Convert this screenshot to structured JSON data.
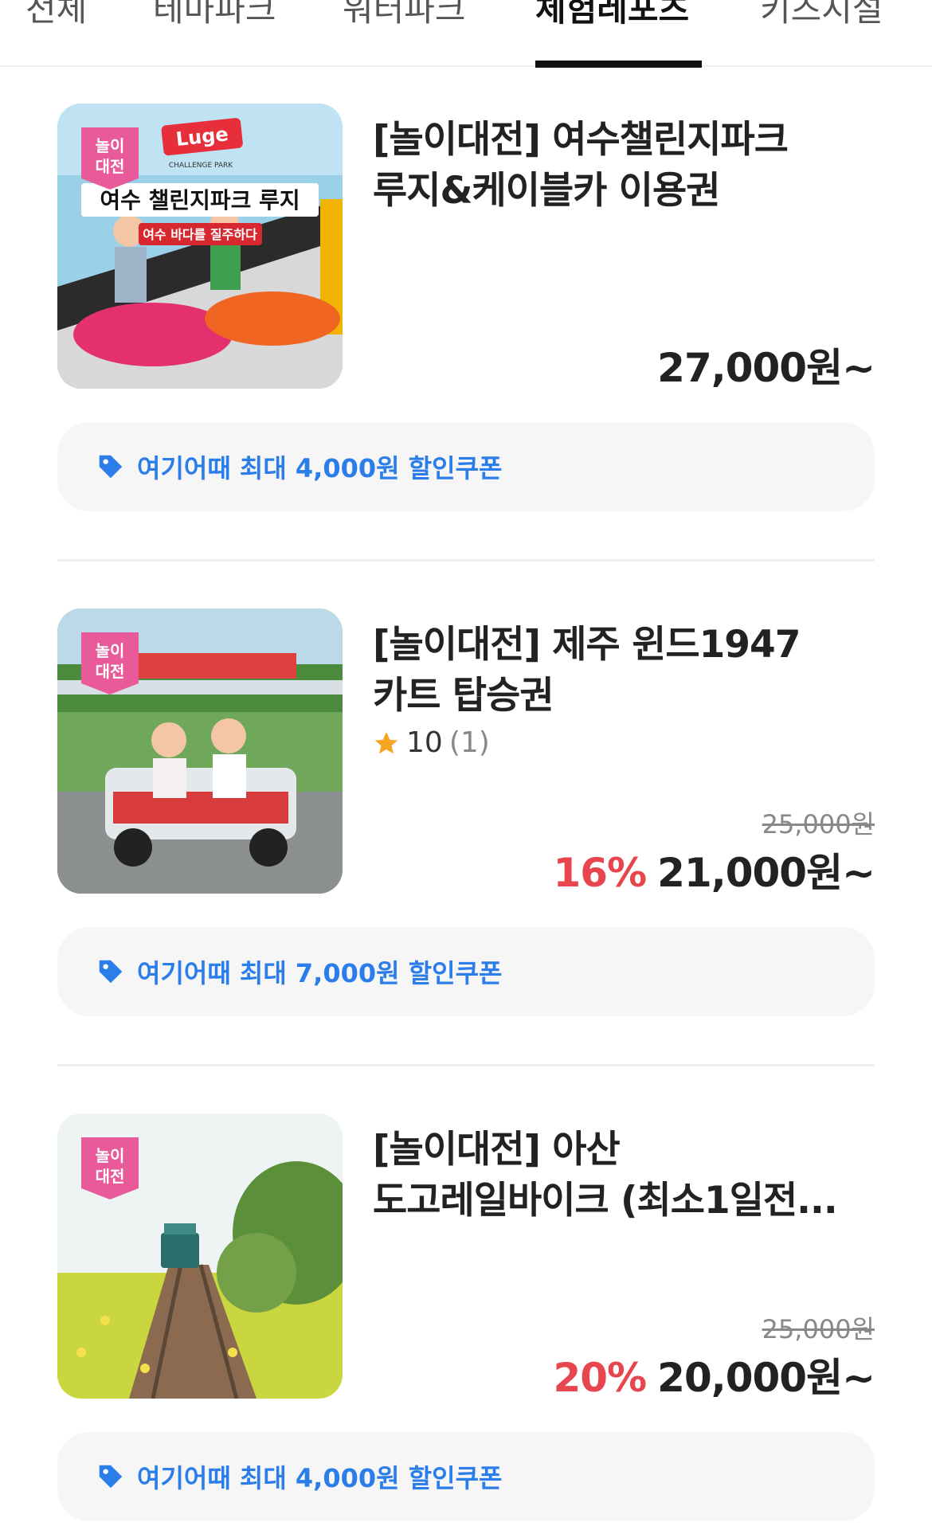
{
  "tabs": [
    {
      "label": "전체",
      "active": false
    },
    {
      "label": "테마파크",
      "active": false
    },
    {
      "label": "워터파크",
      "active": false
    },
    {
      "label": "체험레포츠",
      "active": true
    },
    {
      "label": "키즈시설",
      "active": false
    }
  ],
  "products": [
    {
      "badge_line1": "놀이",
      "badge_line2": "대전",
      "title_line1": "[놀이대전] 여수챌린지파크",
      "title_line2": "루지&케이블카 이용권",
      "rating": null,
      "rating_count": null,
      "original_price": null,
      "discount": null,
      "price": "27,000원~",
      "coupon": "여기어때 최대 4,000원 할인쿠폰",
      "image_text": {
        "logo": "Luge",
        "logo_sub": "CHALLENGE PARK",
        "headline": "여수 챌린지파크 루지",
        "subline": "여수 바다를 질주하다"
      }
    },
    {
      "badge_line1": "놀이",
      "badge_line2": "대전",
      "title_line1": "[놀이대전] 제주 윈드1947",
      "title_line2": "카트 탑승권",
      "rating": "10",
      "rating_count": "(1)",
      "original_price": "25,000원",
      "discount": "16%",
      "price": "21,000원~",
      "coupon": "여기어때 최대 7,000원 할인쿠폰"
    },
    {
      "badge_line1": "놀이",
      "badge_line2": "대전",
      "title_line1": "[놀이대전] 아산",
      "title_line2": "도고레일바이크 (최소1일전...",
      "rating": null,
      "rating_count": null,
      "original_price": "25,000원",
      "discount": "20%",
      "price": "20,000원~",
      "coupon": "여기어때 최대 4,000원 할인쿠폰"
    }
  ],
  "colors": {
    "accent_blue": "#2b7de9",
    "discount_red": "#e8464e",
    "badge_pink": "#e85a9a",
    "star_yellow": "#f5a623"
  },
  "icons": {
    "coupon": "tag-icon",
    "rating": "star-icon"
  }
}
